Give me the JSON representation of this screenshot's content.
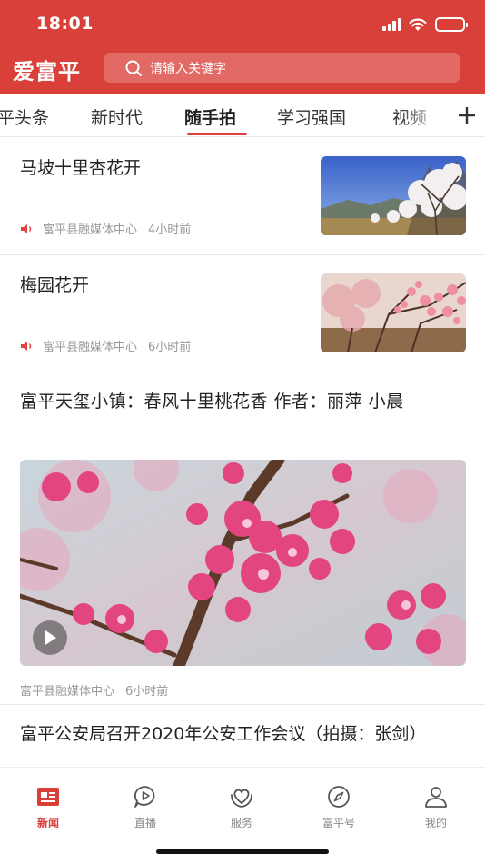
{
  "status_bar": {
    "time": "18:01"
  },
  "header": {
    "brand": "爱富平",
    "search_placeholder": "请输入关键字"
  },
  "colors": {
    "brand_red": "#d9403a",
    "tab_underline": "#d9403a",
    "meta_gray": "#999999"
  },
  "tabs": [
    {
      "label": "平头条",
      "active": false
    },
    {
      "label": "新时代",
      "active": false
    },
    {
      "label": "随手拍",
      "active": true
    },
    {
      "label": "学习强国",
      "active": false
    },
    {
      "label": "视频",
      "active": false
    }
  ],
  "feed": [
    {
      "title": "马坡十里杏花开",
      "source": "富平县融媒体中心",
      "time": "4小时前",
      "audio": true,
      "thumb": "apricot-blossom-mountain"
    },
    {
      "title": "梅园花开",
      "source": "富平县融媒体中心",
      "time": "6小时前",
      "audio": true,
      "thumb": "plum-blossom-orchard"
    },
    {
      "title": "富平天玺小镇：春风十里桃花香 作者：丽萍 小晨",
      "source": "富平县融媒体中心",
      "time": "6小时前",
      "video": true,
      "image": "peach-blossom-closeup"
    },
    {
      "title": "富平公安局召开2020年公安工作会议（拍摄：张剑）"
    }
  ],
  "bottom_nav": [
    {
      "label": "新闻",
      "icon": "news-icon",
      "active": true
    },
    {
      "label": "直播",
      "icon": "live-icon",
      "active": false
    },
    {
      "label": "服务",
      "icon": "service-icon",
      "active": false
    },
    {
      "label": "富平号",
      "icon": "compass-icon",
      "active": false
    },
    {
      "label": "我的",
      "icon": "profile-icon",
      "active": false
    }
  ]
}
